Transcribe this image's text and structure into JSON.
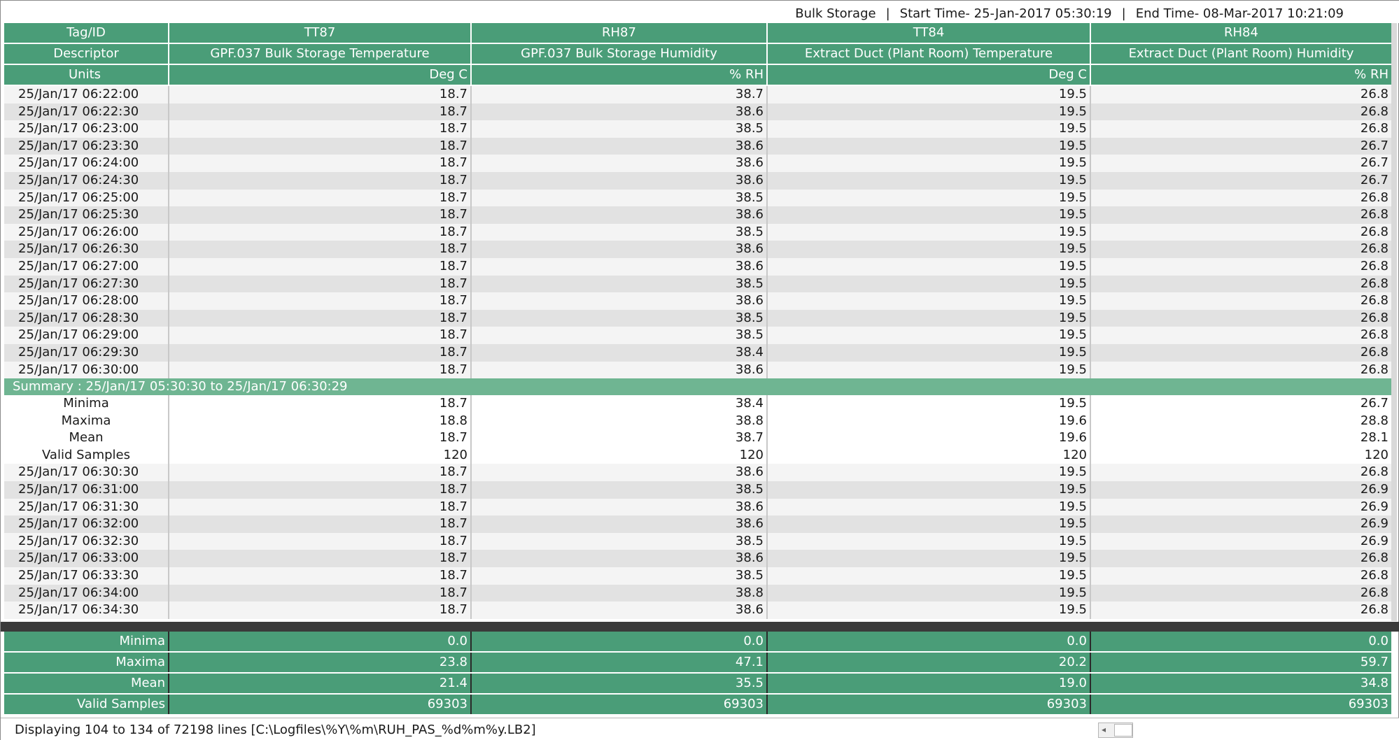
{
  "header": {
    "location": "Bulk Storage",
    "separator": "|",
    "start_time": "Start Time- 25-Jan-2017 05:30:19",
    "end_time": "End Time- 08-Mar-2017 10:21:09"
  },
  "columns": {
    "tag_label": "Tag/ID",
    "descriptor_label": "Descriptor",
    "units_label": "Units",
    "tags": [
      "TT87",
      "RH87",
      "TT84",
      "RH84"
    ],
    "descriptors": [
      "GPF.037 Bulk Storage Temperature",
      "GPF.037 Bulk Storage Humidity",
      "Extract Duct (Plant Room) Temperature",
      "Extract Duct (Plant Room) Humidity"
    ],
    "units": [
      "Deg C",
      "% RH",
      "Deg C",
      "% RH"
    ]
  },
  "rows_a": [
    [
      "25/Jan/17 06:22:00",
      "18.7",
      "38.7",
      "19.5",
      "26.8"
    ],
    [
      "25/Jan/17 06:22:30",
      "18.7",
      "38.6",
      "19.5",
      "26.8"
    ],
    [
      "25/Jan/17 06:23:00",
      "18.7",
      "38.5",
      "19.5",
      "26.8"
    ],
    [
      "25/Jan/17 06:23:30",
      "18.7",
      "38.6",
      "19.5",
      "26.7"
    ],
    [
      "25/Jan/17 06:24:00",
      "18.7",
      "38.6",
      "19.5",
      "26.7"
    ],
    [
      "25/Jan/17 06:24:30",
      "18.7",
      "38.6",
      "19.5",
      "26.7"
    ],
    [
      "25/Jan/17 06:25:00",
      "18.7",
      "38.5",
      "19.5",
      "26.8"
    ],
    [
      "25/Jan/17 06:25:30",
      "18.7",
      "38.6",
      "19.5",
      "26.8"
    ],
    [
      "25/Jan/17 06:26:00",
      "18.7",
      "38.5",
      "19.5",
      "26.8"
    ],
    [
      "25/Jan/17 06:26:30",
      "18.7",
      "38.6",
      "19.5",
      "26.8"
    ],
    [
      "25/Jan/17 06:27:00",
      "18.7",
      "38.6",
      "19.5",
      "26.8"
    ],
    [
      "25/Jan/17 06:27:30",
      "18.7",
      "38.5",
      "19.5",
      "26.8"
    ],
    [
      "25/Jan/17 06:28:00",
      "18.7",
      "38.6",
      "19.5",
      "26.8"
    ],
    [
      "25/Jan/17 06:28:30",
      "18.7",
      "38.5",
      "19.5",
      "26.8"
    ],
    [
      "25/Jan/17 06:29:00",
      "18.7",
      "38.5",
      "19.5",
      "26.8"
    ],
    [
      "25/Jan/17 06:29:30",
      "18.7",
      "38.4",
      "19.5",
      "26.8"
    ],
    [
      "25/Jan/17 06:30:00",
      "18.7",
      "38.6",
      "19.5",
      "26.8"
    ]
  ],
  "summary": {
    "title": "Summary : 25/Jan/17 05:30:30 to  25/Jan/17 06:30:29",
    "rows": [
      [
        "Minima",
        "18.7",
        "38.4",
        "19.5",
        "26.7"
      ],
      [
        "Maxima",
        "18.8",
        "38.8",
        "19.6",
        "28.8"
      ],
      [
        "Mean",
        "18.7",
        "38.7",
        "19.6",
        "28.1"
      ],
      [
        "Valid Samples",
        "120",
        "120",
        "120",
        "120"
      ]
    ]
  },
  "rows_b": [
    [
      "25/Jan/17 06:30:30",
      "18.7",
      "38.6",
      "19.5",
      "26.8"
    ],
    [
      "25/Jan/17 06:31:00",
      "18.7",
      "38.5",
      "19.5",
      "26.9"
    ],
    [
      "25/Jan/17 06:31:30",
      "18.7",
      "38.6",
      "19.5",
      "26.9"
    ],
    [
      "25/Jan/17 06:32:00",
      "18.7",
      "38.6",
      "19.5",
      "26.9"
    ],
    [
      "25/Jan/17 06:32:30",
      "18.7",
      "38.5",
      "19.5",
      "26.9"
    ],
    [
      "25/Jan/17 06:33:00",
      "18.7",
      "38.6",
      "19.5",
      "26.8"
    ],
    [
      "25/Jan/17 06:33:30",
      "18.7",
      "38.5",
      "19.5",
      "26.8"
    ],
    [
      "25/Jan/17 06:34:00",
      "18.7",
      "38.8",
      "19.5",
      "26.8"
    ],
    [
      "25/Jan/17 06:34:30",
      "18.7",
      "38.6",
      "19.5",
      "26.8"
    ]
  ],
  "totals": [
    [
      "Minima",
      "0.0",
      "0.0",
      "0.0",
      "0.0"
    ],
    [
      "Maxima",
      "23.8",
      "47.1",
      "20.2",
      "59.7"
    ],
    [
      "Mean",
      "21.4",
      "35.5",
      "19.0",
      "34.8"
    ],
    [
      "Valid Samples",
      "69303",
      "69303",
      "69303",
      "69303"
    ]
  ],
  "status": {
    "text": "Displaying 104 to 134 of 72198 lines [C:\\Logfiles\\%Y\\%m\\RUH_PAS_%d%m%y.LB2]",
    "scroll_left_arrow": "◂"
  },
  "colors": {
    "header_green": "#4a9d78",
    "summary_green": "#6fb592",
    "row_light": "#f4f4f4",
    "row_dark": "#e2e2e2"
  }
}
